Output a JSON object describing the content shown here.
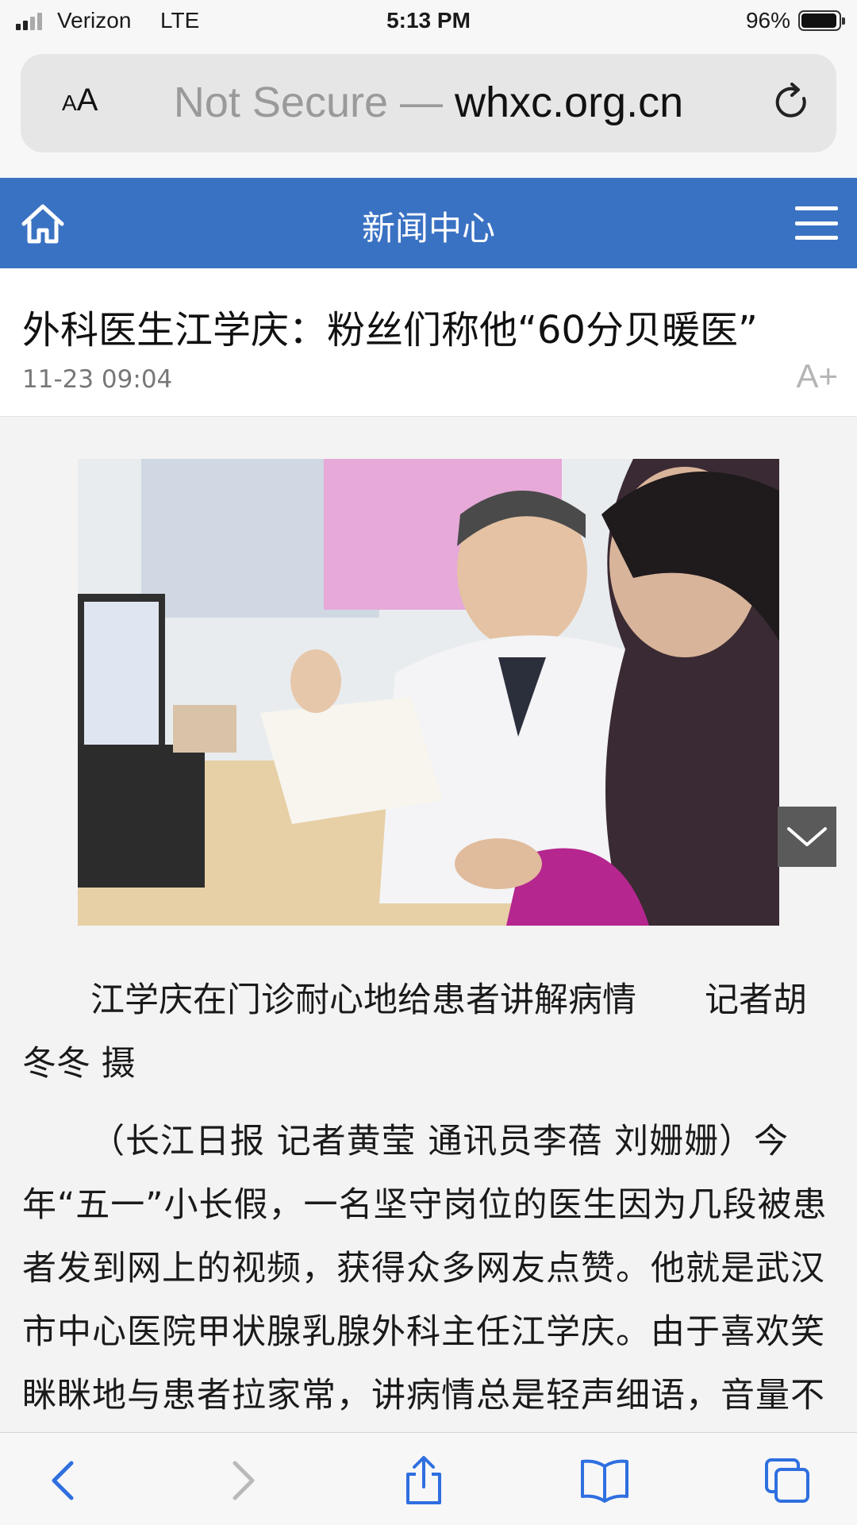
{
  "status_bar": {
    "carrier": "Verizon",
    "network": "LTE",
    "time": "5:13 PM",
    "battery_percent": "96%",
    "battery_level": 0.96
  },
  "url_bar": {
    "text_size_label_small": "A",
    "text_size_label_large": "A",
    "security_prefix": "Not Secure — ",
    "domain": "whxc.org.cn"
  },
  "nav": {
    "title": "新闻中心"
  },
  "article": {
    "title": "外科医生江学庆：粉丝们称他“60分贝暖医”",
    "date": "11-23 09:04",
    "font_size_button": "A+",
    "photo_caption": "江学庆在门诊耐心地给患者讲解病情　　记者胡冬冬 摄",
    "body": "（长江日报 记者黄莹 通讯员李蓓 刘姗姗）今年“五一”小长假，一名坚守岗位的医生因为几段被患者发到网上的视频，获得众多网友点赞。他就是武汉市中心医院甲状腺乳腺外科主任江学庆。由于喜欢笑眯眯地与患者拉家常，讲病情总是轻声细语，音量不超"
  },
  "colors": {
    "header_blue": "#3a72c3",
    "toolbar_blue": "#2f6fe0"
  },
  "toolbar": {
    "icons": [
      "back-icon",
      "forward-icon",
      "share-icon",
      "bookmarks-icon",
      "tabs-icon"
    ]
  }
}
